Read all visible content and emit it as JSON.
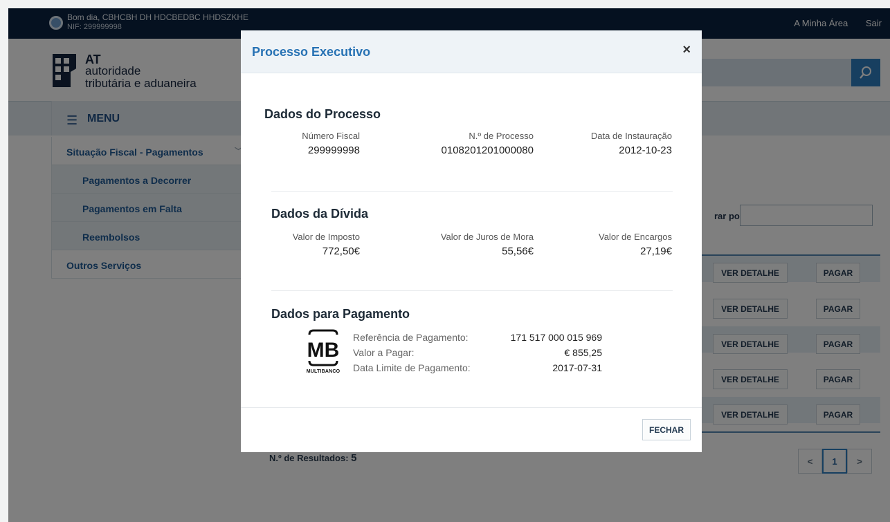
{
  "topbar": {
    "greeting": "Bom dia, CBHCBH DH HDCBEDBC HHDSZKHE",
    "nif": "NIF: 299999998",
    "links": [
      "A Minha Área",
      "Sair"
    ]
  },
  "brand": {
    "short": "AT",
    "line1": "autoridade",
    "line2": "tributária e aduaneira"
  },
  "menu": {
    "label": "MENU"
  },
  "sidebar": {
    "items": [
      {
        "label": "Situação Fiscal - Pagamentos",
        "sub": false
      },
      {
        "label": "Pagamentos a Decorrer",
        "sub": true
      },
      {
        "label": "Pagamentos em Falta",
        "sub": true
      },
      {
        "label": "Reembolsos",
        "sub": true
      },
      {
        "label": "Outros Serviços",
        "sub": false
      }
    ]
  },
  "table": {
    "filter_label": "rar por:",
    "ver_label": "VER DETALHE",
    "pagar_label": "PAGAR",
    "results_label": "N.º de Resultados:",
    "results_count": "5",
    "pagination": {
      "prev": "<",
      "current": "1",
      "next": ">"
    }
  },
  "modal": {
    "title": "Processo Executivo",
    "close": "×",
    "processo": {
      "title": "Dados do Processo",
      "fields": [
        {
          "label": "Número Fiscal",
          "value": "299999998"
        },
        {
          "label": "N.º de Processo",
          "value": "0108201201000080"
        },
        {
          "label": "Data de Instauração",
          "value": "2012-10-23"
        }
      ]
    },
    "divida": {
      "title": "Dados da Dívida",
      "fields": [
        {
          "label": "Valor de Imposto",
          "value": "772,50€"
        },
        {
          "label": "Valor de Juros de Mora",
          "value": "55,56€"
        },
        {
          "label": "Valor de Encargos",
          "value": "27,19€"
        }
      ]
    },
    "pagamento": {
      "title": "Dados para Pagamento",
      "logo_text": "MULTIBANCO",
      "rows": [
        {
          "label": "Referência de Pagamento:",
          "value": "171 517 000 015 969"
        },
        {
          "label": "Valor a Pagar:",
          "value": "€ 855,25"
        },
        {
          "label": "Data Limite de Pagamento:",
          "value": "2017-07-31"
        }
      ]
    },
    "footer_button": "FECHAR"
  },
  "colors": {
    "topbar": "#0b2240",
    "accent": "#2772b4",
    "link": "#1e5a96"
  }
}
